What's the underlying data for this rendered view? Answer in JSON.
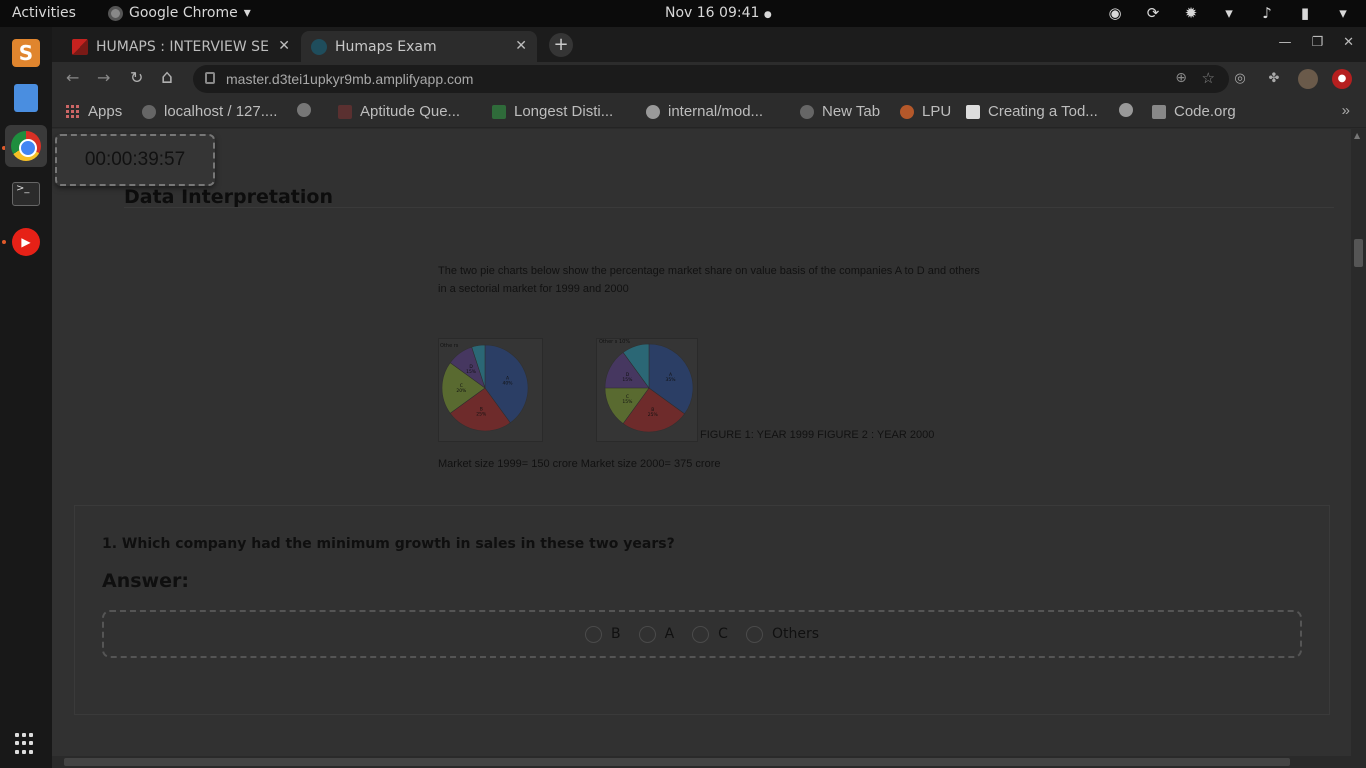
{
  "topbar": {
    "activities": "Activities",
    "app_name": "Google Chrome",
    "app_arrow": "▾",
    "clock": "Nov 16  09:41",
    "clock_dot": "●"
  },
  "tabs": [
    {
      "title": "HUMAPS : INTERVIEW SE",
      "icon": "gmail-icon"
    },
    {
      "title": "Humaps Exam",
      "icon": "react-icon"
    }
  ],
  "tab_close": "✕",
  "new_tab": "+",
  "window_controls": {
    "minimize": "—",
    "restore": "❐",
    "close": "✕"
  },
  "toolbar": {
    "back": "←",
    "forward": "→",
    "reload": "↻",
    "home": "⌂",
    "url": "master.d3tei1upkyr9mb.amplifyapp.com",
    "zoom": "⊕",
    "star": "☆"
  },
  "bookmarks": [
    {
      "label": "Apps"
    },
    {
      "label": "localhost / 127...."
    },
    {
      "label": ""
    },
    {
      "label": "Aptitude Que..."
    },
    {
      "label": "Longest Disti..."
    },
    {
      "label": "internal/mod..."
    },
    {
      "label": "New Tab"
    },
    {
      "label": "LPU"
    },
    {
      "label": "Creating a Tod..."
    },
    {
      "label": "Code.org"
    }
  ],
  "bookmarks_more": "»",
  "page": {
    "timer": "00:00:39:57",
    "section_title": "Data Interpretation",
    "intro": "The two pie charts below show the percentage market share on value basis of the companies A to D and others in a sectorial market for 1999 and 2000",
    "figure_caption": "FIGURE 1: YEAR 1999 FIGURE 2 : YEAR 2000",
    "market_size": "Market size 1999= 150 crore Market size 2000= 375 crore",
    "question": "1. Which company had the minimum growth in sales in these two years?",
    "answer_label": "Answer:",
    "options": [
      "B",
      "A",
      "C",
      "Others"
    ]
  },
  "pie1": {
    "slices": [
      {
        "label": "A",
        "value": 40,
        "text": "40%",
        "color": "#1f4aa0"
      },
      {
        "label": "B",
        "value": 25,
        "text": "25%",
        "color": "#b32020"
      },
      {
        "label": "C",
        "value": 20,
        "text": "20%",
        "color": "#86ab2c"
      },
      {
        "label": "D",
        "value": 10,
        "text": "15%",
        "color": "#5c3a96"
      },
      {
        "label": "Others",
        "value": 5,
        "text": "5%",
        "color": "#1fa4c4"
      }
    ],
    "other_label": "Othe rs"
  },
  "pie2": {
    "slices": [
      {
        "label": "A",
        "value": 35,
        "text": "35%",
        "color": "#1f4aa0"
      },
      {
        "label": "B",
        "value": 25,
        "text": "25%",
        "color": "#b32020"
      },
      {
        "label": "C",
        "value": 15,
        "text": "15%",
        "color": "#86ab2c"
      },
      {
        "label": "D",
        "value": 15,
        "text": "15%",
        "color": "#5c3a96"
      },
      {
        "label": "Others",
        "value": 10,
        "text": "10%",
        "color": "#1fa4c4"
      }
    ],
    "other_label": "Other s 10%"
  },
  "colors": {
    "dim_overlay": "#313131",
    "topbar": "#0b0b0b",
    "dock": "#181818"
  }
}
